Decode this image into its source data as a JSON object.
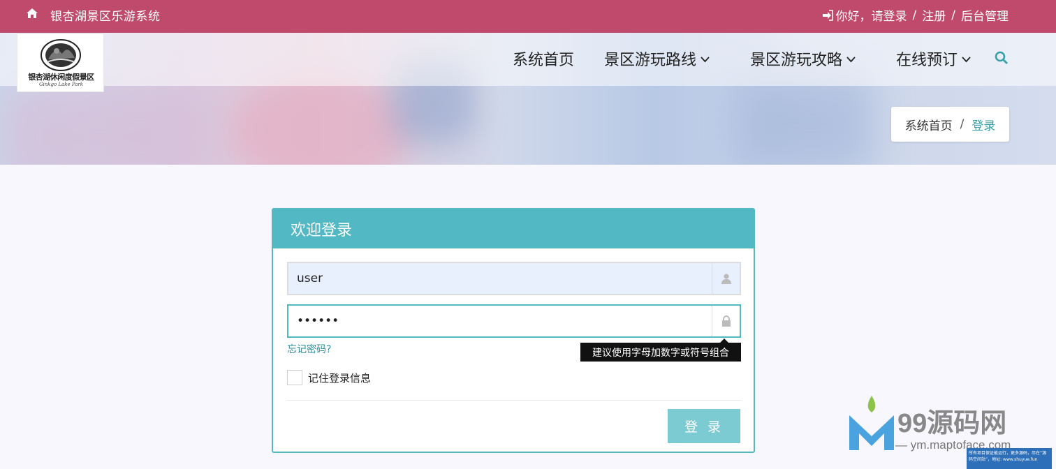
{
  "topbar": {
    "site_name": "银杏湖景区乐游系统",
    "greeting": "你好，请登录",
    "register": "注册",
    "admin": "后台管理",
    "sep": "/",
    "bg_color": "#c04a6c"
  },
  "logo": {
    "text": "银杏湖休闲度假景区",
    "sub": "Ginkgo Lake Park"
  },
  "nav": {
    "items": [
      {
        "label": "系统首页"
      },
      {
        "label": "景区游玩路线"
      },
      {
        "label": "景区游玩攻略"
      },
      {
        "label": "在线预订"
      }
    ]
  },
  "breadcrumb": {
    "home": "系统首页",
    "sep": "/",
    "current": "登录"
  },
  "login": {
    "title": "欢迎登录",
    "username_value": "user",
    "password_value": "••••••",
    "forgot": "忘记密码?",
    "tooltip": "建议使用字母加数字或符号组合",
    "remember": "记住登录信息",
    "button": "登 录",
    "accent_color": "#52b8c4"
  },
  "watermark": {
    "brand": "99源码网",
    "url": "— ym.maptoface.com",
    "note": "所有项目保证能运行，更多源码，尽在“源码空间站”，地址: www.shuyue.fun"
  }
}
